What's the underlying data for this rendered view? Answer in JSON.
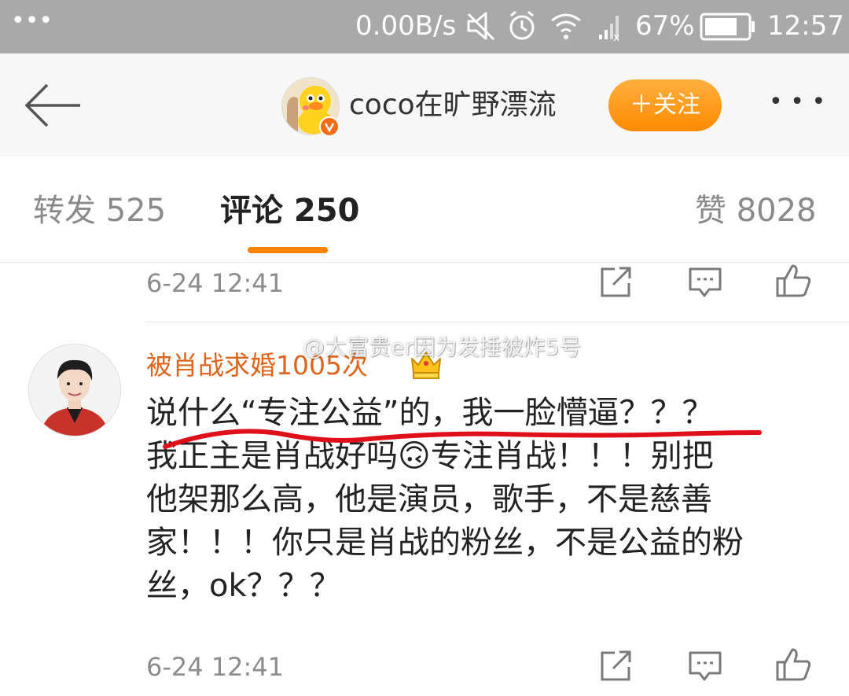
{
  "status_bar": {
    "dots": "•••",
    "net_speed": "0.00B/s",
    "battery_percent": "67%",
    "time": "12:57",
    "icons": [
      "mute-icon",
      "alarm-icon",
      "wifi-icon",
      "signal-icon",
      "battery-icon"
    ]
  },
  "nav": {
    "back_icon": "back-arrow-icon",
    "username": "coco在旷野漂流",
    "follow_label": "＋关注",
    "more_label": "• • •"
  },
  "tabs": [
    {
      "label": "转发 525"
    },
    {
      "label": "评论 250"
    },
    {
      "label": "赞 8028"
    }
  ],
  "comments": [
    {
      "time": "6-24 12:41",
      "actions": [
        "share-icon",
        "comment-icon",
        "like-icon"
      ]
    },
    {
      "username": "被肖战求婚1005次",
      "badge_icon": "crown-emoji-icon",
      "lines": [
        "说什么“专注公益”的，我一脸懵逼？？？",
        "我正主是肖战好吗🙃专注肖战！！！别把",
        "他架那么高，他是演员，歌手，不是慈善",
        "家！！！你只是肖战的粉丝，不是公益的粉",
        "丝，ok？？？"
      ],
      "time": "6-24 12:41",
      "actions": [
        "share-icon",
        "comment-icon",
        "like-icon"
      ]
    }
  ],
  "watermark": "@大富贵er因为发捶被炸5号",
  "colors": {
    "accent": "#ff8200",
    "username": "#e0651c",
    "underline_annotation": "#e0101a"
  }
}
